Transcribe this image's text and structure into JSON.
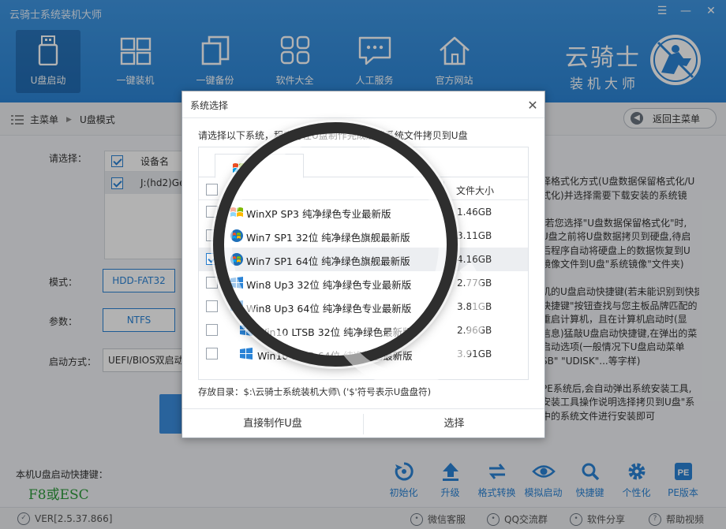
{
  "app": {
    "title": "云骑士系统装机大师",
    "window_controls": [
      "☰",
      "—",
      "✕"
    ]
  },
  "nav": [
    {
      "label": "U盘启动",
      "icon": "usb-drive-icon",
      "active": true
    },
    {
      "label": "一键装机",
      "icon": "windows-logo-icon",
      "active": false
    },
    {
      "label": "一键备份",
      "icon": "copy-pages-icon",
      "active": false
    },
    {
      "label": "软件大全",
      "icon": "apps-grid-icon",
      "active": false
    },
    {
      "label": "人工服务",
      "icon": "chat-bubble-icon",
      "active": false
    },
    {
      "label": "官方网站",
      "icon": "home-icon",
      "active": false
    }
  ],
  "logo": {
    "main": "云骑士",
    "sub": "装机大师"
  },
  "breadcrumb": {
    "home": "主菜单",
    "current": "U盘模式"
  },
  "back_button": "返回主菜单",
  "background": {
    "select_label": "请选择：",
    "device_header": "设备名",
    "device_row": "J:(hd2)Ge",
    "mode_label": "模式：",
    "mode_value": "HDD-FAT32",
    "param_label": "参数：",
    "param_value": "NTFS",
    "boot_label": "启动方式：",
    "boot_value": "UEFI/BIOS双启动",
    "right_lines": [
      "择格式化方式(U盘数据保留格式化/U",
      "式化)并选择需要下载安装的系统镜",
      "",
      "(若您选择\"U盘数据保留格式化\"时,",
      "U盘之前将U盘数据拷贝到硬盘,待启",
      "后程序自动将硬盘上的数据恢复到U",
      "镜像文件到U盘\"系统镜像\"文件夹)",
      "",
      "机的U盘启动快捷键(若未能识别到快捷",
      "快捷键\"按钮查找与您主板品牌匹配的",
      "重启计算机，且在计算机启动时(显",
      "信息)猛敲U盘启动快捷键,在弹出的菜",
      "启动选项(一般情况下U盘启动菜单",
      "SB\" \"UDISK\"...等字样)",
      "",
      "PE系统后,会自动弹出系统安装工具,",
      "安装工具操作说明选择拷贝到U盘\"系",
      "中的系统文件进行安装即可"
    ]
  },
  "hotkey": {
    "label": "本机U盘启动快捷键：",
    "value": "F8或ESC"
  },
  "tools": [
    {
      "label": "初始化",
      "icon": "reset-icon"
    },
    {
      "label": "升级",
      "icon": "upgrade-icon"
    },
    {
      "label": "格式转换",
      "icon": "convert-icon"
    },
    {
      "label": "模拟启动",
      "icon": "eye-icon"
    },
    {
      "label": "快捷键",
      "icon": "search-icon"
    },
    {
      "label": "个性化",
      "icon": "gear-icon"
    },
    {
      "label": "PE版本",
      "icon": "pe-icon"
    }
  ],
  "status": {
    "version": "VER[2.5.37.866]",
    "wechat": "微信客服",
    "qq": "QQ交流群",
    "share": "软件分享",
    "help": "帮助视频"
  },
  "modal": {
    "title": "系统选择",
    "intro": "请选择以下系统，程序将在U盘制作完成后将系统文件拷贝到U盘",
    "size_header": "文件大小",
    "systems": [
      {
        "name": "WinXP SP3 纯净绿色专业最新版",
        "size": "1.46GB",
        "checked": false
      },
      {
        "name": "Win7 SP1 32位 纯净绿色旗舰最新版",
        "size": "3.11GB",
        "checked": false
      },
      {
        "name": "Win7 SP1 64位 纯净绿色旗舰最新版",
        "size": "4.16GB",
        "checked": true
      },
      {
        "name": "Win8 Up3 32位 纯净绿色专业最新版",
        "size": "2.77GB",
        "checked": false
      },
      {
        "name": "Win8 Up3 64位 纯净绿色专业最新版",
        "size": "3.81GB",
        "checked": false
      },
      {
        "name": "Win10 LTSB 32位 纯净绿色最新版",
        "size": "2.96GB",
        "checked": false
      },
      {
        "name": "Win10 LTSB 64位 纯净绿色最新版",
        "size": "3.91GB",
        "checked": false
      }
    ],
    "save_path": "存放目录：$:\\云骑士系统装机大师\\ ('$'符号表示U盘盘符)",
    "btn_direct": "直接制作U盘",
    "btn_select": "选择"
  }
}
